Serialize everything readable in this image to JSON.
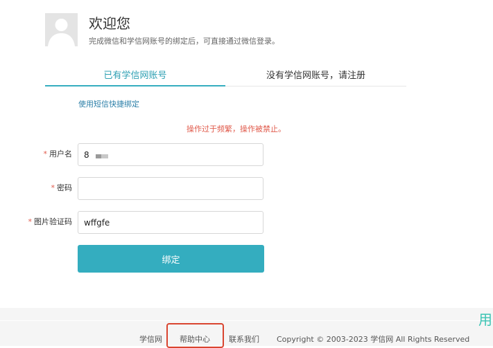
{
  "header": {
    "title": "欢迎您",
    "subtitle": "完成微信和学信网账号的绑定后，可直接通过微信登录。"
  },
  "tabs": [
    {
      "label": "已有学信网账号",
      "active": true
    },
    {
      "label": "没有学信网账号，请注册",
      "active": false
    }
  ],
  "sms_link": "使用短信快捷绑定",
  "error_message": "操作过于频繁，操作被禁止。",
  "form": {
    "required_mark": "*",
    "username": {
      "label": "用户名",
      "value": "8"
    },
    "password": {
      "label": "密码",
      "value": ""
    },
    "captcha": {
      "label": "图片验证码",
      "value": "wffgfe"
    },
    "submit_label": "绑定"
  },
  "footer": {
    "links": [
      "学信网",
      "帮助中心",
      "联系我们"
    ],
    "copyright": "Copyright © 2003-2023  学信网  All Rights Reserved"
  },
  "side_char": "用",
  "colors": {
    "accent": "#34adbf",
    "error": "#e05a4b",
    "link": "#2b7fa8",
    "highlight": "#d9442f"
  },
  "icons": {
    "avatar": "user-avatar-placeholder"
  }
}
